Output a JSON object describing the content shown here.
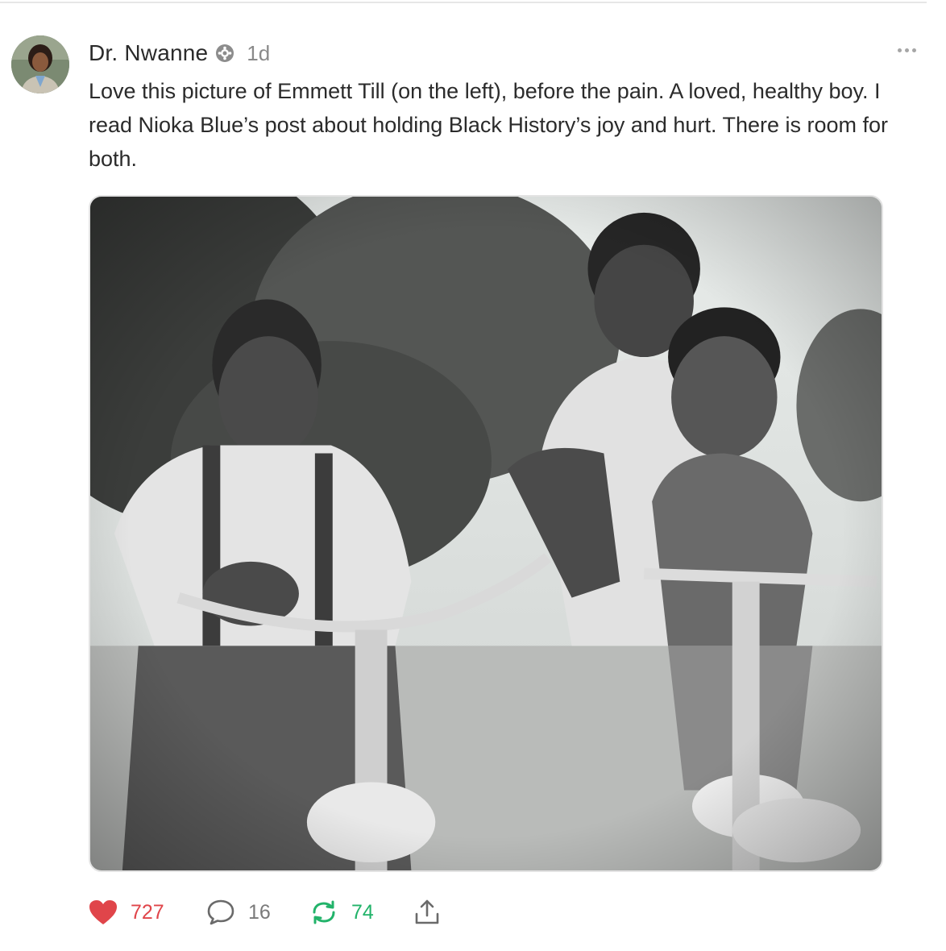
{
  "post": {
    "author": "Dr. Nwanne",
    "time": "1d",
    "text": "Love this picture of Emmett Till (on the left), before the pain. A loved, healthy boy. I read Nioka Blue’s post about holding Black History’s joy and hurt. There is room for both."
  },
  "actions": {
    "likes": "727",
    "replies": "16",
    "reposts": "74"
  },
  "icons": {
    "verified": "verified-badge-icon",
    "more": "more-options-icon",
    "like": "heart-icon",
    "reply": "speech-bubble-icon",
    "repost": "repost-arrows-icon",
    "share": "share-upload-icon"
  },
  "colors": {
    "like": "#e0454a",
    "repost": "#22b36a",
    "muted": "#7a7a7a"
  }
}
